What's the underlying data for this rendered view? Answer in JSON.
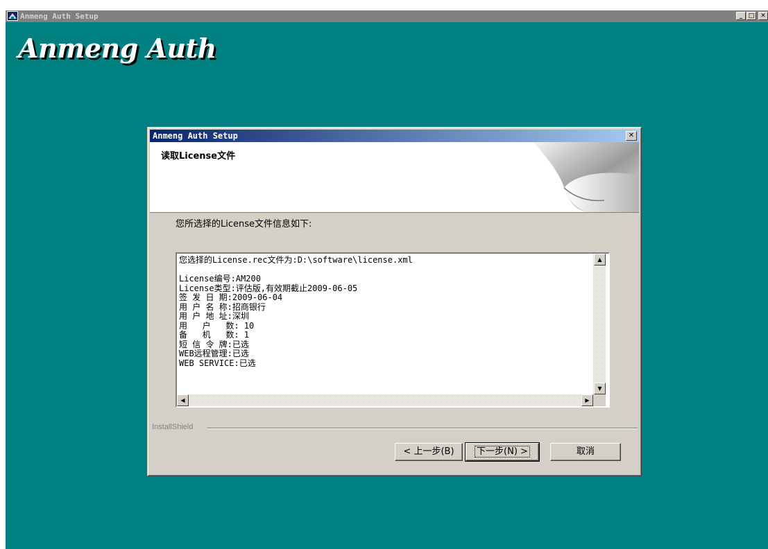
{
  "window": {
    "title": "Anmeng Auth Setup",
    "buttons": {
      "minimize": "_",
      "maximize": "□",
      "close": "✕"
    }
  },
  "banner": {
    "title": "Anmeng Auth"
  },
  "dialog": {
    "title": "Anmeng Auth Setup",
    "close": "✕",
    "heading": "读取License文件",
    "intro": "您所选择的License文件信息如下:",
    "info_lines": [
      "您选择的License.rec文件为:D:\\software\\license.xml",
      "",
      "License编号:AM200",
      "License类型:评估版,有效期截止2009-06-05",
      "签 发 日 期:2009-06-04",
      "用 户 名 称:招商银行",
      "用 户 地 址:深圳",
      "用   户   数: 10",
      "备   机   数: 1",
      "短 信 令 牌:已选",
      "WEB远程管理:已选",
      "WEB SERVICE:已选"
    ],
    "scroll": {
      "up": "▲",
      "down": "▼",
      "left": "◀",
      "right": "▶"
    },
    "footer_label": "InstallShield",
    "buttons": {
      "back": "< 上一步(B)",
      "next": "下一步(N) >",
      "cancel": "取消"
    }
  },
  "colors": {
    "desktop": "#008080",
    "dialog_face": "#d4d0c8",
    "active_title_start": "#0a246a",
    "active_title_end": "#a6caf0"
  }
}
